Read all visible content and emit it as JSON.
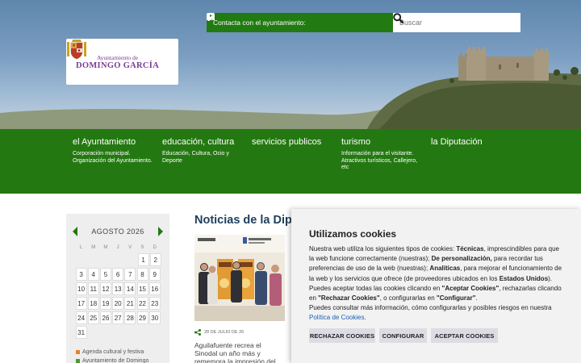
{
  "header": {
    "contact_label": "Contacta con el ayuntamiento:",
    "contact_icons": [
      "envelope-icon",
      "sitemap-icon",
      "map-marker-icon",
      "facebook-icon",
      "twitter-icon",
      "youtube-icon"
    ],
    "search_placeholder": "Buscar",
    "logo": {
      "line1": "Ayuntamiento de",
      "line2": "DOMINGO GARCÍA"
    }
  },
  "nav": [
    {
      "title": "el Ayuntamiento",
      "desc": "Corporación municipal. Organización del Ayuntamiento."
    },
    {
      "title": "educación, cultura",
      "desc": "Educación, Cultura, Ocio y Deporte"
    },
    {
      "title": "servicios publicos",
      "desc": ""
    },
    {
      "title": "turismo",
      "desc": "Información para el visitante. Atractivos turísticos, Callejero, etc"
    },
    {
      "title": "la Diputación",
      "desc": ""
    }
  ],
  "calendar": {
    "month": "AGOSTO 2026",
    "dows": [
      "L",
      "M",
      "M",
      "J",
      "V",
      "S",
      "D"
    ],
    "weeks": [
      [
        "",
        "",
        "",
        "",
        "",
        "1",
        "2"
      ],
      [
        "3",
        "4",
        "5",
        "6",
        "7",
        "8",
        "9"
      ],
      [
        "10",
        "11",
        "12",
        "13",
        "14",
        "15",
        "16"
      ],
      [
        "17",
        "18",
        "19",
        "20",
        "21",
        "22",
        "23"
      ],
      [
        "24",
        "25",
        "26",
        "27",
        "28",
        "29",
        "30"
      ],
      [
        "31",
        "",
        "",
        "",
        "",
        "",
        ""
      ]
    ],
    "legend": [
      {
        "label": "Agenda cultural y festiva",
        "color": "#e8812a"
      },
      {
        "label": "Ayuntamiento de Domingo",
        "color": "#4a9a32"
      }
    ]
  },
  "news": {
    "title": "Noticias de la Diputación",
    "items": [
      {
        "date": "28 DE JULIO DE 26",
        "headline": "Aguilafuente recrea el Sinodal un año más y rememora la impresión del primer libro en España"
      }
    ]
  },
  "cookies": {
    "title": "Utilizamos cookies",
    "p1_a": "Nuestra web utiliza los siguientes tipos de cookies: ",
    "p1_b": "Técnicas",
    "p1_c": ", imprescindibles para que la web funcione correctamente (nuestras); ",
    "p1_d": "De personalización,",
    "p1_e": " para recordar tus preferencias de uso de la web (nuestras); ",
    "p1_f": "Analíticas",
    "p1_g": ", para mejorar el funcionamiento de la web y los servicios que ofrece (de proveedores ubicados en los ",
    "p1_h": "Estados Unidos",
    "p1_i": ").",
    "p2_a": "Puedes aceptar todas las cookies clicando en ",
    "p2_b": "\"Aceptar Cookies\"",
    "p2_c": ", rechazarlas clicando en ",
    "p2_d": "\"Rechazar Cookies\"",
    "p2_e": ", o configurarlas en ",
    "p2_f": "\"Configurar\"",
    "p2_g": ".",
    "p3_a": "Puedes consultar más información, cómo configurarlas y posibles riesgos en nuestra ",
    "p3_link": "Política de Cookies",
    "p3_b": ".",
    "buttons": {
      "reject": "RECHAZAR COOKIES",
      "configure": "CONFIGURAR",
      "accept": "ACEPTAR COOKIES"
    }
  },
  "colors": {
    "green": "#247811",
    "cookie_bg": "#f2f2f2",
    "title_blue": "#1e3e5e",
    "link": "#1a5fb4"
  }
}
